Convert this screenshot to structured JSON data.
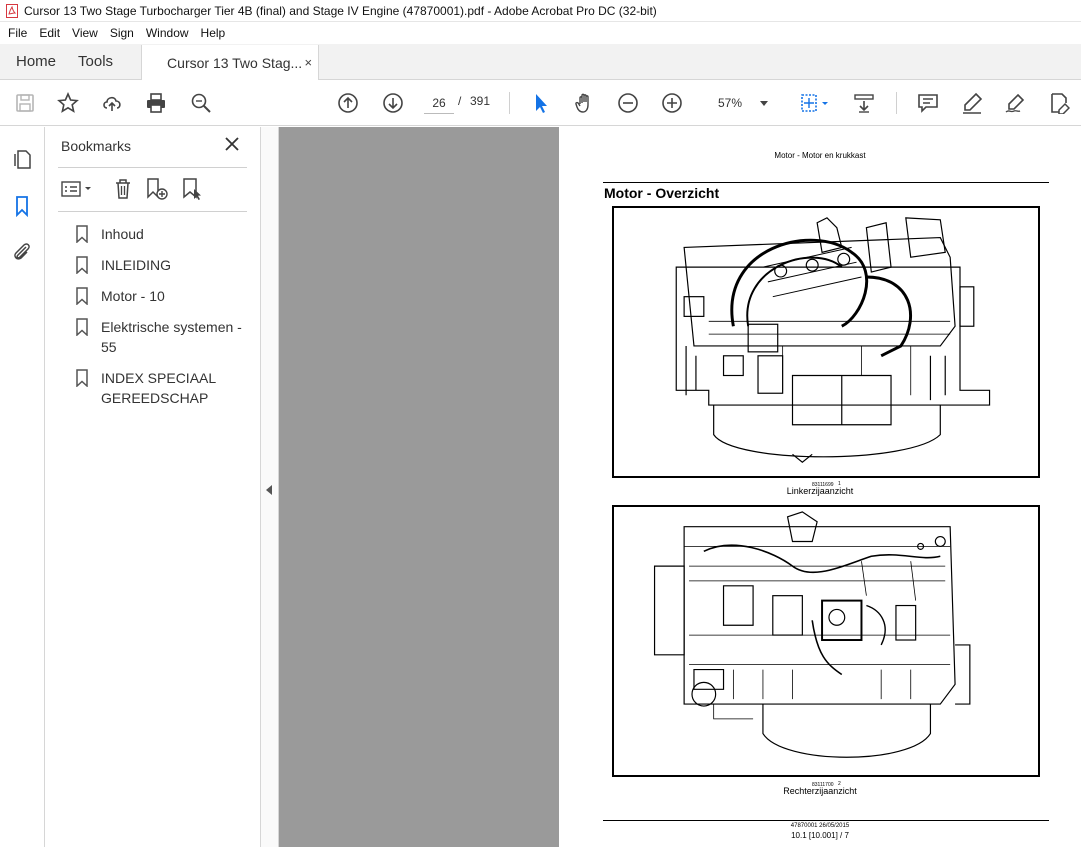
{
  "window": {
    "title": "Cursor 13 Two Stage Turbocharger Tier 4B (final) and Stage IV Engine (47870001).pdf - Adobe Acrobat Pro DC (32-bit)"
  },
  "menu": [
    "File",
    "Edit",
    "View",
    "Sign",
    "Window",
    "Help"
  ],
  "tabs": {
    "home": "Home",
    "tools": "Tools",
    "document": "Cursor 13 Two Stag...",
    "close_glyph": "×"
  },
  "toolbar": {
    "current_page": "26",
    "page_separator": "/",
    "total_pages": "391",
    "zoom": "57%",
    "icons": [
      "save-icon",
      "star-icon",
      "upload-icon",
      "print-icon",
      "search-zoom-icon",
      "page-up-icon",
      "page-down-icon",
      "select-cursor-icon",
      "hand-icon",
      "zoom-out-icon",
      "zoom-in-icon",
      "fit-page-icon",
      "scroll-mode-icon",
      "comment-icon",
      "highlight-icon",
      "sign-icon",
      "edit-pdf-icon"
    ]
  },
  "bookmarks": {
    "title": "Bookmarks",
    "items": [
      {
        "label": "Inhoud"
      },
      {
        "label": "INLEIDING"
      },
      {
        "label": "Motor - 10"
      },
      {
        "label": "Elektrische systemen - 55"
      },
      {
        "label": "INDEX SPECIAAL GEREEDSCHAP"
      }
    ]
  },
  "page": {
    "header": "Motor - Motor en krukkast",
    "heading": "Motor - Overzicht",
    "figures": [
      {
        "code": "83111699",
        "number": "1",
        "caption": "Linkerzijaanzicht"
      },
      {
        "code": "83111700",
        "number": "2",
        "caption": "Rechterzijaanzicht"
      }
    ],
    "footer_code": "47870001 26/05/2015",
    "footer_page": "10.1 [10.001] / 7"
  },
  "colors": {
    "accent_blue": "#1473e6",
    "app_red": "#d7373f",
    "viewer_gray": "#9a9a9a"
  }
}
